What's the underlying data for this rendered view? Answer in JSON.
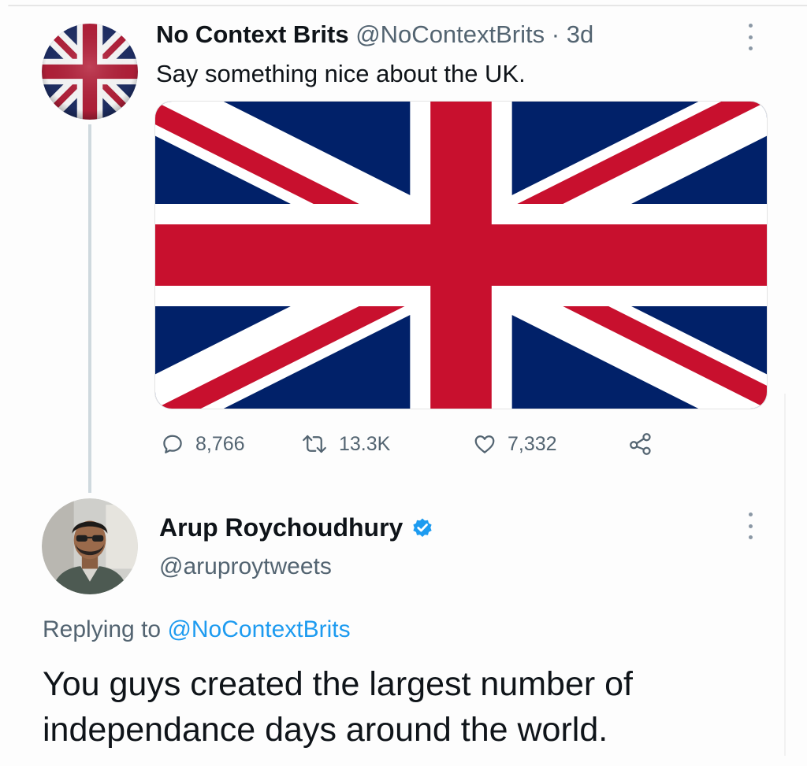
{
  "tweet": {
    "author": {
      "display_name": "No Context Brits",
      "handle": "@NoContextBrits",
      "separator": "·",
      "time": "3d",
      "avatar_icon": "union-jack-avatar"
    },
    "text": "Say something nice about the UK.",
    "media": {
      "icon": "union-jack-flag",
      "colors": {
        "blue": "#012169",
        "red": "#c8102e",
        "white": "#ffffff"
      }
    },
    "actions": {
      "reply": {
        "icon": "reply-icon",
        "count": "8,766"
      },
      "retweet": {
        "icon": "retweet-icon",
        "count": "13.3K"
      },
      "like": {
        "icon": "heart-icon",
        "count": "7,332"
      },
      "share": {
        "icon": "share-icon"
      }
    },
    "more_icon": "more-vertical-icon"
  },
  "reply": {
    "author": {
      "display_name": "Arup Roychoudhury",
      "handle": "@aruproytweets",
      "verified": true,
      "verified_icon": "verified-badge-icon",
      "avatar_icon": "user-photo-avatar"
    },
    "replying_to_label": "Replying to",
    "replying_to_handle": "@NoContextBrits",
    "text": "You guys created the largest number of independance days around the world.",
    "more_icon": "more-vertical-icon"
  },
  "colors": {
    "text_primary": "#0f1419",
    "text_secondary": "#536471",
    "accent": "#1d9bf0",
    "thread_line": "#cfd9de"
  }
}
